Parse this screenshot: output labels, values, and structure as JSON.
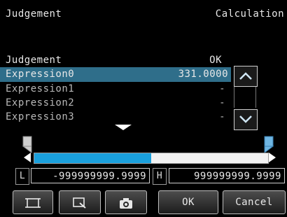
{
  "header": {
    "left_title": "Judgement",
    "right_title": "Calculation"
  },
  "list": {
    "judgement": {
      "label": "Judgement",
      "value": "OK"
    },
    "items": [
      {
        "label": "Expression0",
        "value": "331.0000",
        "selected": true
      },
      {
        "label": "Expression1",
        "value": "-"
      },
      {
        "label": "Expression2",
        "value": "-"
      },
      {
        "label": "Expression3",
        "value": "-"
      }
    ]
  },
  "range": {
    "fill_fraction": 0.5,
    "fill_color": "#1aa0dd"
  },
  "limits": {
    "low_tag": "L",
    "low_value": "-999999999.9999",
    "high_tag": "H",
    "high_value": "999999999.9999"
  },
  "footer": {
    "ok_label": "OK",
    "cancel_label": "Cancel"
  },
  "icons": [
    "frame-icon",
    "zoom-icon",
    "camera-icon",
    "scroll-up-icon",
    "scroll-down-icon",
    "more-down-icon"
  ],
  "colors": {
    "selection": "#2f6e8a",
    "accent": "#1aa0dd"
  }
}
